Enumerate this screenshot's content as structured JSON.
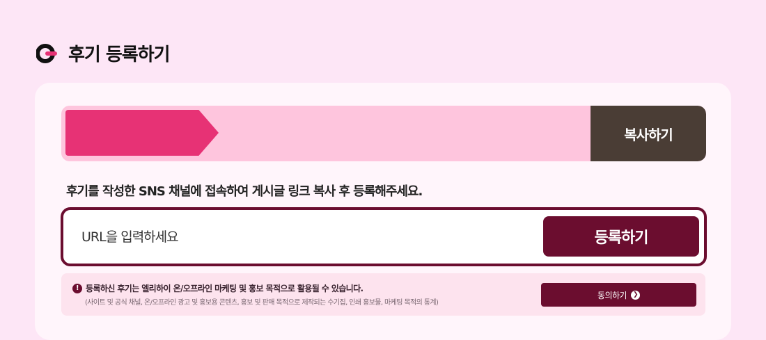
{
  "header": {
    "title": "후기 등록하기",
    "icon": "review-logo-icon",
    "accent_color": "#e73275"
  },
  "link_bar": {
    "copy_label": "복사하기",
    "arrow_color": "#e73275",
    "bar_color": "#fec5dd",
    "copy_button_color": "#4a3d35"
  },
  "instruction": "후기를 작성한 SNS 채널에 접속하여 게시글 링크 복사 후 등록해주세요.",
  "url_form": {
    "placeholder": "URL을 입력하세요",
    "value": "",
    "register_label": "등록하기",
    "button_color": "#6b0d2f"
  },
  "consent": {
    "icon": "exclamation-icon",
    "main_text": "등록하신 후기는 엘리하이 온/오프라인 마케팅 및 홍보 목적으로 활용될 수 있습니다.",
    "sub_text": "(사이트 및 공식 채널, 온/오프라인 광고 및 홍보용 콘텐츠, 홍보 및 판매 목적으로 제작되는 수기집, 인쇄 홍보물, 마케팅 목적의 통계)",
    "agree_label": "동의하기",
    "agree_icon": "chevron-right-circle-icon"
  }
}
